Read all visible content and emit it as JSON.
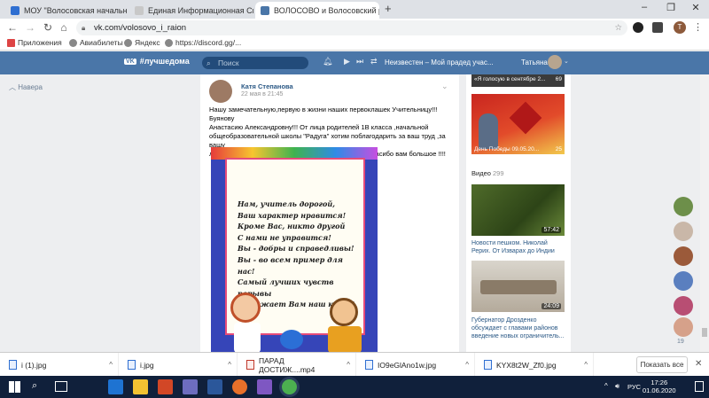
{
  "browser": {
    "tabs": [
      {
        "title": "МОУ \"Волосовская начальная о",
        "active": false
      },
      {
        "title": "Единая Информационная Систе",
        "active": false
      },
      {
        "title": "ВОЛОСОВО и Волосовский рай",
        "active": true
      }
    ],
    "new_tab_label": "+",
    "url": "vk.com/volosovo_i_raion",
    "bookmarks": [
      "Приложения",
      "Авиабилеты",
      "Яндекс",
      "https://discord.gg/..."
    ]
  },
  "vk_header": {
    "hashtag": "#лучшедома",
    "search_placeholder": "Поиск",
    "track": "Неизвестен – Мой прадед учас...",
    "user": "Татьяна"
  },
  "left_nav": {
    "back_label": "Навера"
  },
  "post": {
    "author": "Катя Степанова",
    "date": "22 мая в 21:45",
    "text_lines": [
      "Нашу замечательную,первую в жизни наших первоклашек Учительницу!!! Буянову",
      "Анастасию Александровну!!! От лица родителей 1В класса ,начальной",
      "общеобразовательной школы \"Радуга\" хотим поблагодарить за ваш труд ,за вашу",
      "любовь и понимание в отношении к нашим детям. Спасибо вам большое !!!!"
    ],
    "verse_lines": [
      "Нам, учитель дорогой,",
      "Ваш характер нравится!",
      "Кроме Вас, никто другой",
      "С нами не управится!",
      "Вы - добры и справедливы!",
      "Вы - во всем пример для нас!",
      "Самый лучших чувств порывы",
      "Выражает Вам наш класс!"
    ]
  },
  "right_col": {
    "top_caption": "«Я голосую в сентябре 2...",
    "top_count": "69",
    "news_caption": "День Победы 09.05.20...",
    "news_count": "25",
    "video_header": "Видео",
    "video_count": "299",
    "videos": [
      {
        "title": "Новости пешком. Николай Рерих. От Изварах до Индии",
        "duration": "57:42"
      },
      {
        "title": "Губернатор Дрозденко обсуждает с главами районов введение новых ограничитель...",
        "duration": "24:09"
      }
    ],
    "friends_badge": "19"
  },
  "downloads": {
    "items": [
      "i (1).jpg",
      "i.jpg",
      "ПАРАД ДОСТИЖ....mp4",
      "IO9eGlAno1w.jpg",
      "KYX8t2W_Zf0.jpg"
    ],
    "show_all": "Показать все"
  },
  "taskbar": {
    "lang": "РУС",
    "time": "17:26",
    "date": "01.06.2020"
  }
}
